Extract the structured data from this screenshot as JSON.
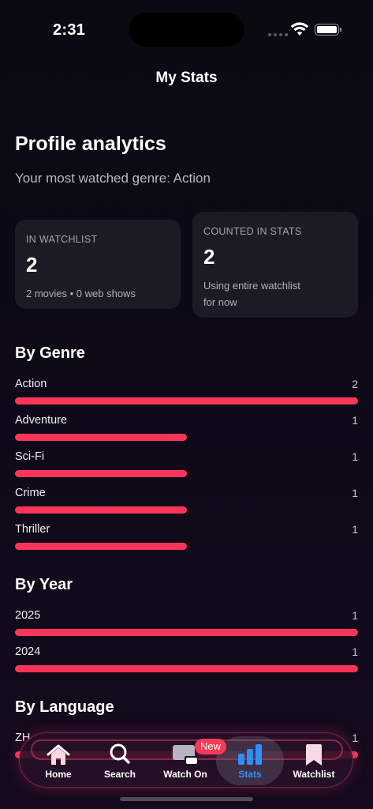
{
  "status_bar": {
    "time": "2:31"
  },
  "nav": {
    "title": "My Stats"
  },
  "profile": {
    "heading": "Profile analytics",
    "most_watched": "Your most watched genre: Action"
  },
  "cards": {
    "watchlist": {
      "label": "IN WATCHLIST",
      "value": "2",
      "note": "2 movies • 0 web shows"
    },
    "counted": {
      "label": "COUNTED IN STATS",
      "value": "2",
      "note_line1": "Using entire watchlist",
      "note_line2": "for now"
    }
  },
  "by_genre": {
    "title": "By Genre",
    "rows": [
      {
        "label": "Action",
        "count": "2",
        "fraction": 1.0
      },
      {
        "label": "Adventure",
        "count": "1",
        "fraction": 0.5
      },
      {
        "label": "Sci-Fi",
        "count": "1",
        "fraction": 0.5
      },
      {
        "label": "Crime",
        "count": "1",
        "fraction": 0.5
      },
      {
        "label": "Thriller",
        "count": "1",
        "fraction": 0.5
      }
    ]
  },
  "by_year": {
    "title": "By Year",
    "rows": [
      {
        "label": "2025",
        "count": "1",
        "fraction": 1.0
      },
      {
        "label": "2024",
        "count": "1",
        "fraction": 1.0
      }
    ]
  },
  "by_language": {
    "title": "By Language",
    "rows": [
      {
        "label": "ZH",
        "count": "1",
        "fraction": 1.0
      }
    ]
  },
  "tab_bar": {
    "tabs": [
      {
        "label": "Home",
        "icon": "house-icon"
      },
      {
        "label": "Search",
        "icon": "magnifier-icon"
      },
      {
        "label": "Watch On",
        "icon": "tv-devices-icon",
        "badge": "New"
      },
      {
        "label": "Stats",
        "icon": "bar-chart-icon",
        "active": true
      },
      {
        "label": "Watchlist",
        "icon": "bookmark-icon"
      }
    ]
  },
  "colors": {
    "accent_bar": "#fb3559",
    "active_tab": "#2e8fff",
    "badge": "#f53b55",
    "card_bg": "#1c1a24"
  }
}
